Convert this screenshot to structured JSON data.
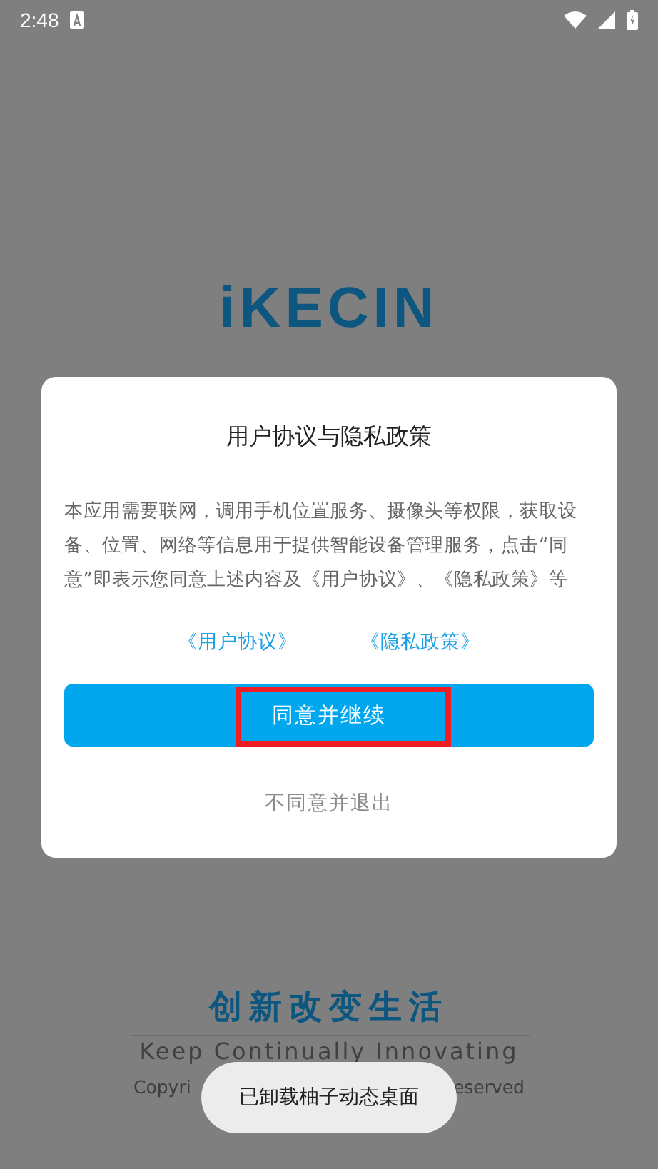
{
  "status_bar": {
    "time": "2:48"
  },
  "logo": {
    "text": "iKECIN"
  },
  "dialog": {
    "title": "用户协议与隐私政策",
    "body": "本应用需要联网，调用手机位置服务、摄像头等权限，获取设备、位置、网络等信息用于提供智能设备管理服务，点击“同意”即表示您同意上述内容及《用户协议》、《隐私政策》等",
    "links": [
      "《用户协议》",
      "《隐私政策》"
    ],
    "primary_button": {
      "label": "同意并继续",
      "highlighted": true
    },
    "secondary_button": "不同意并退出"
  },
  "slogan": "创新改变生活",
  "tagline": "Keep Continually Innovating",
  "copyright_fragments": [
    "Copyri",
    "eserved"
  ],
  "toast": "已卸载柚子动态桌面"
}
